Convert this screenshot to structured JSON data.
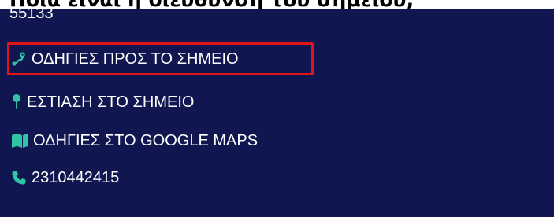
{
  "header": {
    "clipped_title": "Ποια είναι η διεύθυνση του σημείου;"
  },
  "panel": {
    "code": "55133",
    "accent_color": "#2ec4a6",
    "highlight_color": "#e0141a",
    "background_color": "#0f1650",
    "actions": [
      {
        "icon": "route-icon",
        "label": "ΟΔΗΓΙΕΣ ΠΡΟΣ ΤΟ ΣΗΜΕΙΟ"
      },
      {
        "icon": "map-pin-icon",
        "label": "ΕΣΤΙΑΣΗ ΣΤΟ ΣΗΜΕΙΟ"
      },
      {
        "icon": "map-icon",
        "label": "ΟΔΗΓΙΕΣ ΣΤΟ GOOGLE MAPS"
      },
      {
        "icon": "phone-icon",
        "label": "2310442415"
      }
    ]
  }
}
